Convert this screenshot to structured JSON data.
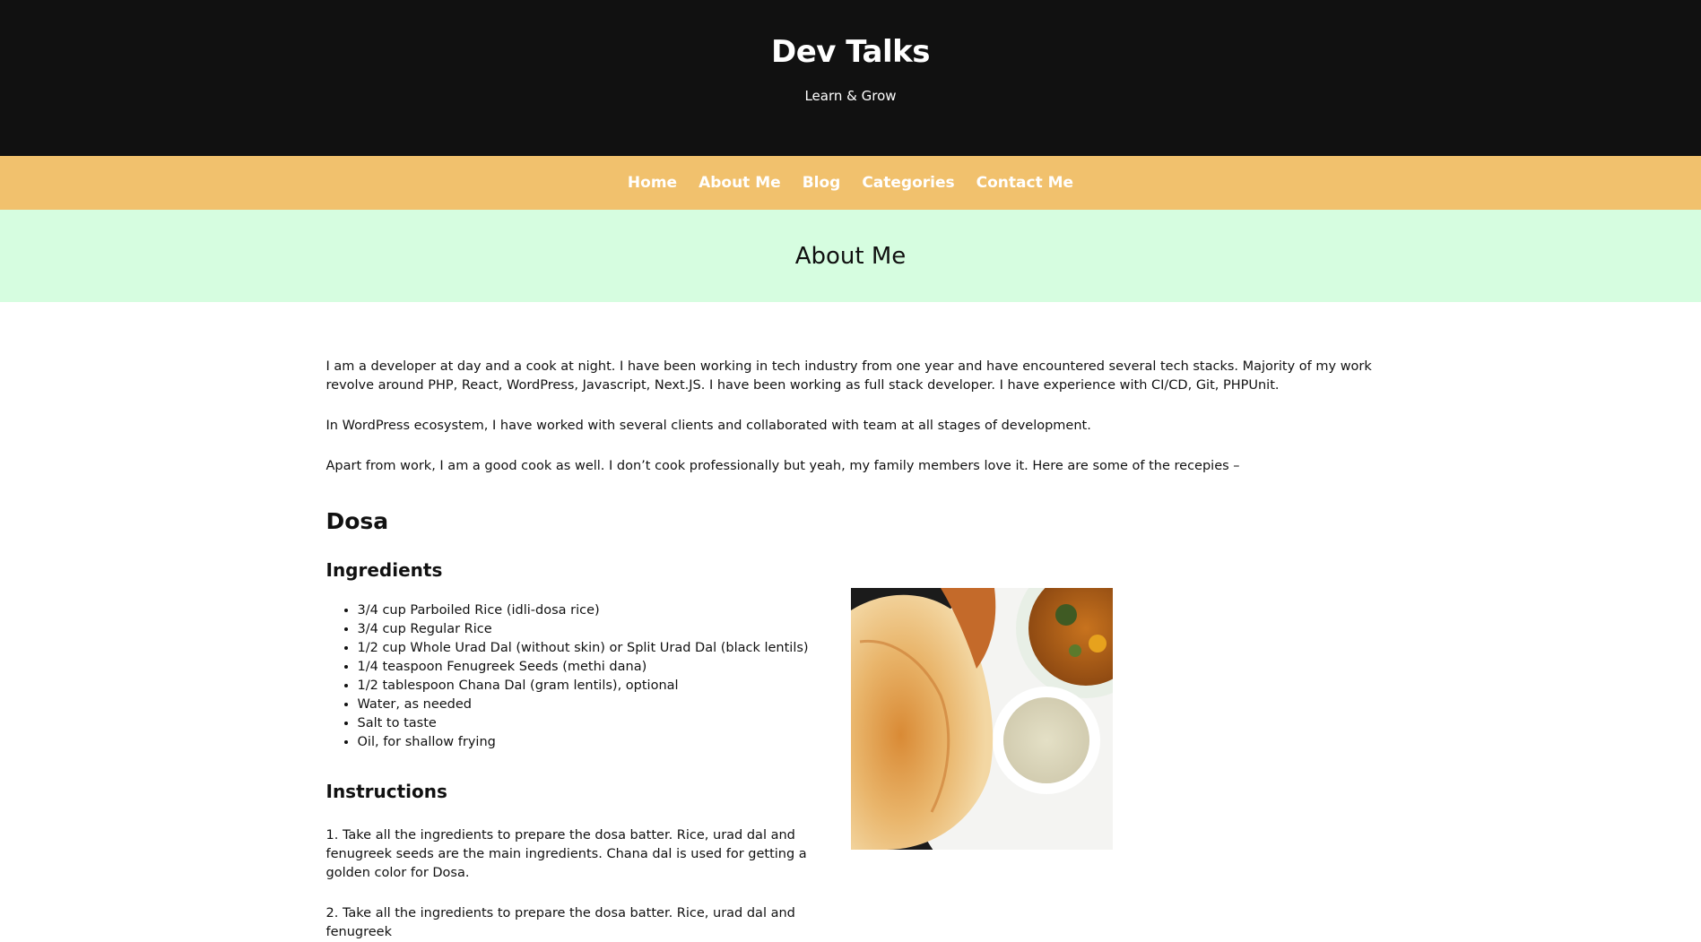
{
  "site": {
    "title": "Dev Talks",
    "tagline": "Learn & Grow"
  },
  "nav": {
    "items": [
      {
        "label": "Home"
      },
      {
        "label": "About Me"
      },
      {
        "label": "Blog"
      },
      {
        "label": "Categories"
      },
      {
        "label": "Contact Me"
      }
    ]
  },
  "page": {
    "title": "About Me"
  },
  "content": {
    "paragraphs": [
      "I am a developer at day and a cook at night. I have been working in tech industry from one year and have encountered several tech stacks. Majority of my work revolve around PHP, React, WordPress, Javascript, Next.JS. I have been working as full stack developer. I have experience with CI/CD, Git, PHPUnit.",
      "In WordPress ecosystem, I have worked with several clients and collaborated with team at all stages of development.",
      "Apart from work, I am a good cook as well. I don’t cook professionally but yeah, my family members love it. Here are some of the recepies –"
    ]
  },
  "recipe": {
    "title": "Dosa",
    "ingredients_heading": "Ingredients",
    "ingredients": [
      "3/4 cup Parboiled Rice (idli-dosa rice)",
      "3/4 cup Regular Rice",
      "1/2 cup Whole Urad Dal (without skin) or Split Urad Dal (black lentils)",
      "1/4 teaspoon Fenugreek Seeds (methi dana)",
      "1/2 tablespoon Chana Dal (gram lentils), optional",
      "Water, as needed",
      "Salt to taste",
      "Oil, for shallow frying"
    ],
    "instructions_heading": "Instructions",
    "instructions": [
      "1. Take all the ingredients to prepare the dosa batter. Rice, urad dal and fenugreek seeds are the main ingredients. Chana dal is used for getting a golden color for Dosa.",
      "2. Take all the ingredients to prepare the dosa batter. Rice, urad dal and fenugreek"
    ]
  },
  "colors": {
    "header_bg": "#111111",
    "nav_bg": "#f1c16d",
    "hero_bg": "#d6fde0"
  }
}
